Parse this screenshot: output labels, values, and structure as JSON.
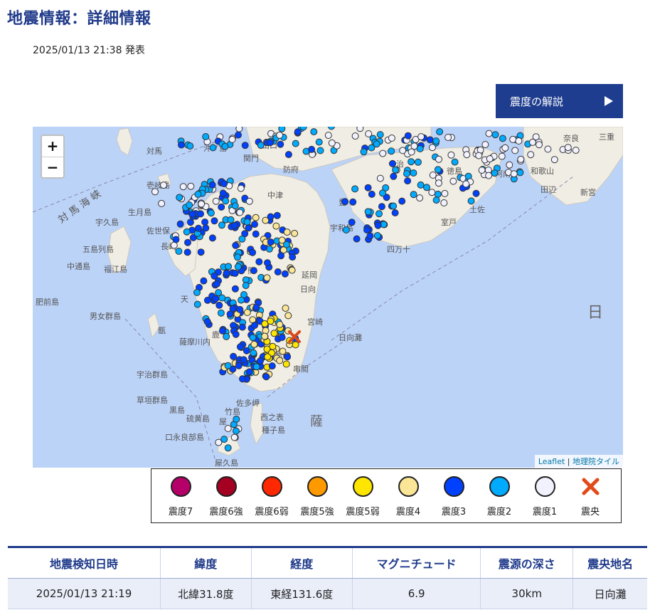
{
  "header": {
    "title": "地震情報：詳細情報",
    "published": "2025/01/13 21:38 発表"
  },
  "guide_button": {
    "label": "震度の解説",
    "icon": "triangle-right-icon"
  },
  "map": {
    "zoom_in": "+",
    "zoom_out": "−",
    "attribution": {
      "leaflet": "Leaflet",
      "separator": " | ",
      "tiles": "地理院タイル"
    },
    "labels": {
      "tsushima": "対馬",
      "okinoshima": "沖ノ島",
      "iki": "壱岐島",
      "yamaguchi": "山口",
      "hofu": "防府",
      "nakatsu": "中津",
      "imabari": "今治",
      "tokushima": "徳島",
      "anan": "阿南",
      "nara": "奈良",
      "mie": "三重",
      "wakayama": "和歌山",
      "tanabe": "田辺",
      "shingu": "新宮",
      "goto": "五島列島",
      "nagasaki": "長崎",
      "fukue": "福江島",
      "sasebo": "佐世保",
      "hirado": "宇久島",
      "nakadori": "中通島",
      "kumamoto": "熊",
      "miyazaki": "宮崎",
      "nobeoka": "延岡",
      "hyuga": "日向",
      "kagoshima": "鹿",
      "satsuma": "薩摩川内",
      "miyakonojo": "都城",
      "kushima": "串間",
      "danjo": "男女群島",
      "hizen": "肥前島",
      "uji": "宇治群島",
      "kusagaki": "草垣群島",
      "kuroshima": "黒島",
      "iojima": "硫黄島",
      "takeshima": "竹島",
      "kuchinoerabu": "口永良部島",
      "yakushima": "屋久島",
      "tanegashima": "種子島",
      "nishinoomote": "西之表",
      "yaku_short": "屋",
      "sata": "佐多岬",
      "uwajima": "宇和島",
      "muroto": "室戸",
      "shimanto": "四万十",
      "tosa": "土佐",
      "kanmon": "関門",
      "hinada": "日",
      "hyuga_nada": "日向灘",
      "sea_name": "対 馬 海 峡",
      "satsunan": "薩",
      "ikishima": "生月島",
      "amakusa": "天",
      "koshiki": "甑",
      "shikoku_sea": "豊"
    }
  },
  "legend": [
    {
      "label": "震度7",
      "color": "#b5006a"
    },
    {
      "label": "震度6強",
      "color": "#a50021"
    },
    {
      "label": "震度6弱",
      "color": "#ff2800"
    },
    {
      "label": "震度5強",
      "color": "#ff9900"
    },
    {
      "label": "震度5弱",
      "color": "#ffe600"
    },
    {
      "label": "震度4",
      "color": "#fae696"
    },
    {
      "label": "震度3",
      "color": "#0041ff"
    },
    {
      "label": "震度2",
      "color": "#00aaff"
    },
    {
      "label": "震度1",
      "color": "#f2f2ff"
    },
    {
      "label": "震央",
      "color": "#e24a1a",
      "icon": "x-mark-icon"
    }
  ],
  "summary": {
    "headers": [
      "地震検知日時",
      "緯度",
      "経度",
      "マグニチュード",
      "震源の深さ",
      "震央地名"
    ],
    "row": [
      "2025/01/13 21:19",
      "北緯31.8度",
      "東経131.6度",
      "6.9",
      "30km",
      "日向灘"
    ]
  }
}
